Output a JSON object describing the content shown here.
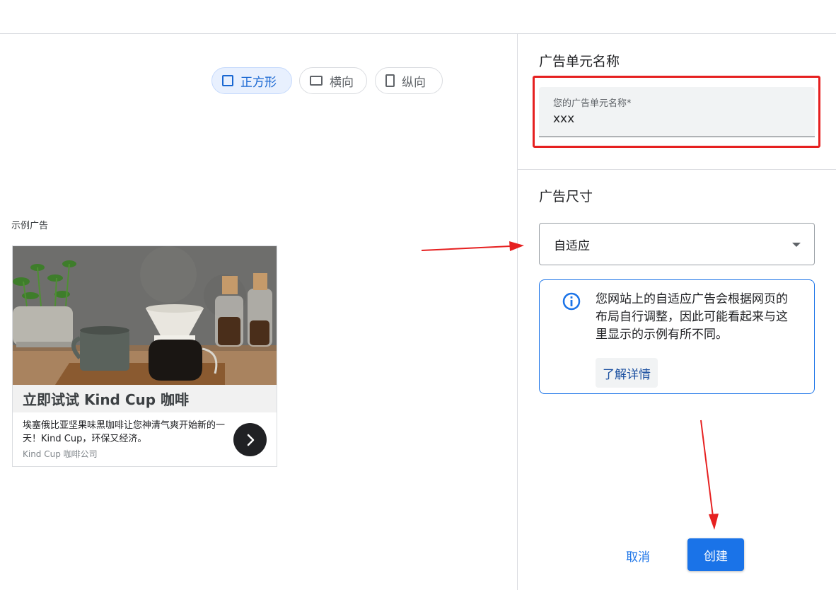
{
  "colors": {
    "accent": "#1a73e8",
    "chip_active_bg": "#e8f0fe",
    "annotation_red": "#e62020"
  },
  "preview": {
    "orientation_options": [
      {
        "label": "正方形",
        "icon": "square-icon",
        "selected": true
      },
      {
        "label": "横向",
        "icon": "landscape-icon",
        "selected": false
      },
      {
        "label": "纵向",
        "icon": "portrait-icon",
        "selected": false
      }
    ],
    "sample_label": "示例广告",
    "ad": {
      "image": "coffee-photo",
      "title": "立即试试 Kind Cup 咖啡",
      "description": "埃塞俄比亚坚果味黑咖啡让您神清气爽开始新的一天！Kind Cup，环保又经济。",
      "advertiser": "Kind Cup 咖啡公司",
      "next_icon": "chevron-right-icon"
    }
  },
  "settings": {
    "name_section_title": "广告单元名称",
    "name_field": {
      "label": "您的广告单元名称*",
      "value": "xxx"
    },
    "size_section_title": "广告尺寸",
    "size_select": {
      "value": "自适应"
    },
    "info": {
      "icon": "info-icon",
      "text": "您网站上的自适应广告会根据网页的布局自行调整，因此可能看起来与这里显示的示例有所不同。",
      "learn_more": "了解详情"
    },
    "actions": {
      "cancel": "取消",
      "create": "创建"
    }
  }
}
